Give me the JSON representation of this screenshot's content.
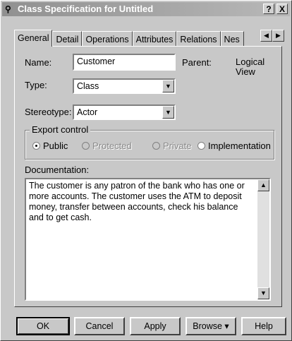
{
  "window": {
    "title": "Class Specification for Untitled",
    "help_button": "?",
    "close_button": "X"
  },
  "tabs": [
    {
      "label": "General",
      "active": true
    },
    {
      "label": "Detail",
      "active": false
    },
    {
      "label": "Operations",
      "active": false
    },
    {
      "label": "Attributes",
      "active": false
    },
    {
      "label": "Relations",
      "active": false
    },
    {
      "label": "Nes",
      "active": false
    }
  ],
  "tab_scroll": {
    "left": "◀",
    "right": "▶"
  },
  "form": {
    "name_label": "Name:",
    "name_value": "Customer",
    "parent_label": "Parent:",
    "parent_value": "Logical View",
    "type_label": "Type:",
    "type_value": "Class",
    "stereotype_label": "Stereotype:",
    "stereotype_value": "Actor"
  },
  "export_control": {
    "title": "Export control",
    "options": [
      {
        "label": "Public",
        "selected": true,
        "enabled": true
      },
      {
        "label": "Protected",
        "selected": false,
        "enabled": false
      },
      {
        "label": "Private",
        "selected": false,
        "enabled": false
      },
      {
        "label": "Implementation",
        "selected": false,
        "enabled": true
      }
    ]
  },
  "documentation": {
    "label": "Documentation:",
    "text": "The customer is any patron of the bank who has one or more accounts. The customer uses the ATM to deposit money, transfer between accounts, check his balance and to get cash."
  },
  "buttons": {
    "ok": "OK",
    "cancel": "Cancel",
    "apply": "Apply",
    "browse": "Browse ▾",
    "help": "Help"
  },
  "icons": {
    "title_icon": "class-spec-icon",
    "dropdown": "chevron-down-icon",
    "scroll_up": "arrow-up-icon",
    "scroll_down": "arrow-down-icon"
  }
}
